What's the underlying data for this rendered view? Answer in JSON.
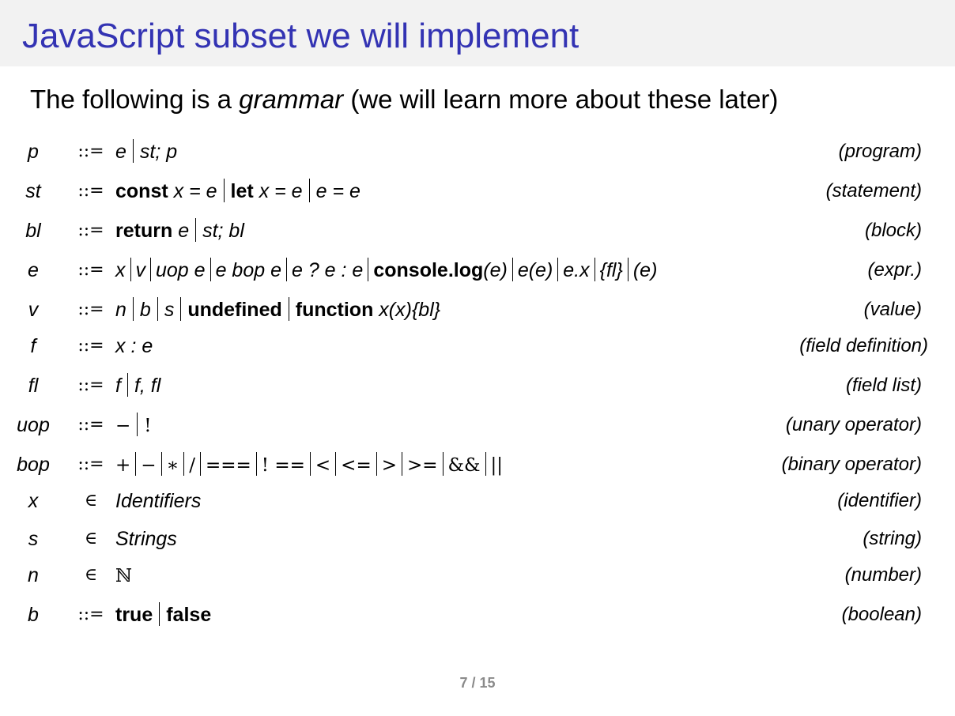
{
  "slide": {
    "title": "JavaScript subset we will implement",
    "intro_before": "The following is a ",
    "intro_emphasis": "grammar",
    "intro_after": " (we will learn more about these later)",
    "page_number": "7 / 15"
  },
  "grammar": [
    {
      "lhs": "p",
      "op": "::=",
      "category": "(program)"
    },
    {
      "lhs": "st",
      "op": "::=",
      "category": "(statement)"
    },
    {
      "lhs": "bl",
      "op": "::=",
      "category": "(block)"
    },
    {
      "lhs": "e",
      "op": "::=",
      "category": "(expr.)"
    },
    {
      "lhs": "v",
      "op": "::=",
      "category": "(value)"
    },
    {
      "lhs": "f",
      "op": "::=",
      "category": "(field definition)"
    },
    {
      "lhs": "fl",
      "op": "::=",
      "category": "(field list)"
    },
    {
      "lhs": "uop",
      "op": "::=",
      "category": "(unary operator)"
    },
    {
      "lhs": "bop",
      "op": "::=",
      "category": "(binary operator)"
    },
    {
      "lhs": "x",
      "op": "∈",
      "category": "(identifier)"
    },
    {
      "lhs": "s",
      "op": "∈",
      "category": "(string)"
    },
    {
      "lhs": "n",
      "op": "∈",
      "category": "(number)"
    },
    {
      "lhs": "b",
      "op": "::=",
      "category": "(boolean)"
    }
  ],
  "rhs_text": {
    "p": [
      "e",
      "st; p"
    ],
    "st": [
      "x = e",
      "x = e",
      "e = e"
    ],
    "st_keywords": [
      "const",
      "let"
    ],
    "bl_keyword": "return",
    "bl": [
      "e",
      "st; bl"
    ],
    "e": [
      "x",
      "v",
      "uop e",
      "e bop e",
      "e ? e : e",
      "(e)",
      "e(e)",
      "e.x",
      "{fl}",
      "(e)"
    ],
    "e_keyword": "console.log",
    "v": [
      "n",
      "b",
      "s",
      "x(x){bl}"
    ],
    "v_keywords": [
      "undefined",
      "function"
    ],
    "f": "x : e",
    "fl": [
      "f",
      "f, fl"
    ],
    "uop": [
      "−",
      "!"
    ],
    "bop": [
      "+",
      "−",
      "∗",
      "/",
      "===",
      "! ==",
      "<",
      "<=",
      ">",
      ">=",
      "&&",
      "||"
    ],
    "x": "Identifiers",
    "s": "Strings",
    "n": "ℕ",
    "b": [
      "true",
      "false"
    ]
  }
}
